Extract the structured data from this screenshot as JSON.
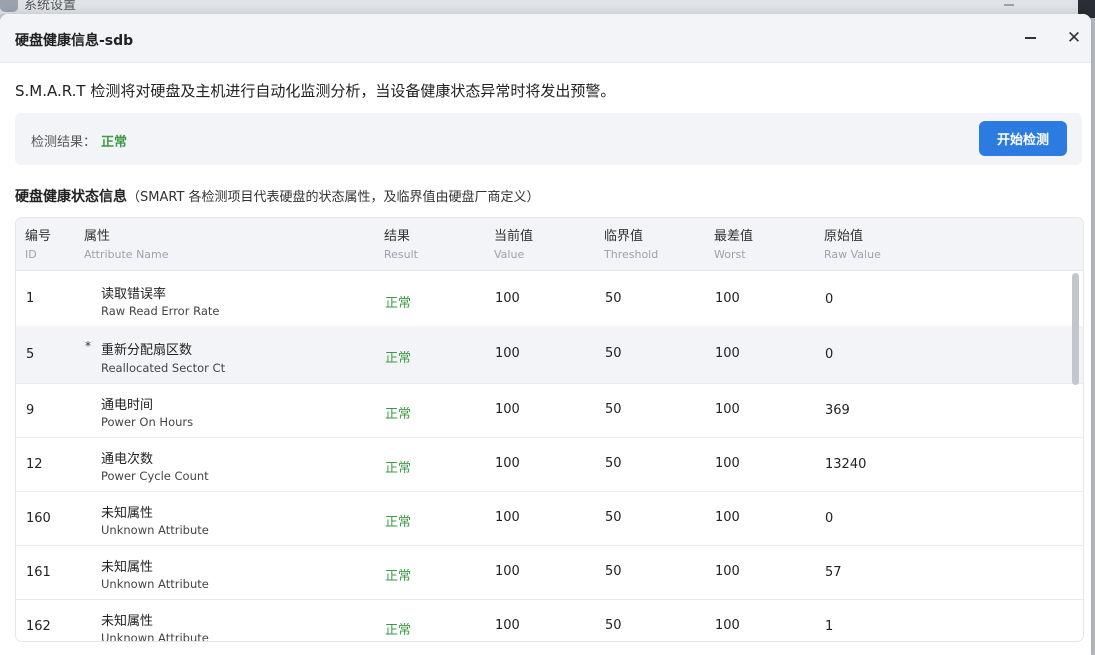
{
  "bg": {
    "title": "系统设置"
  },
  "dialog": {
    "title": "硬盘健康信息-sdb"
  },
  "description": "S.M.A.R.T 检测将对硬盘及主机进行自动化监测分析，当设备健康状态异常时将发出预警。",
  "result": {
    "label": "检测结果：",
    "value": "正常",
    "button": "开始检测"
  },
  "section": {
    "title": "硬盘健康状态信息",
    "note": "（SMART 各检测项目代表硬盘的状态属性，及临界值由硬盘厂商定义）"
  },
  "columns": [
    {
      "cn": "编号",
      "en": "ID"
    },
    {
      "cn": "属性",
      "en": "Attribute Name"
    },
    {
      "cn": "结果",
      "en": "Result"
    },
    {
      "cn": "当前值",
      "en": "Value"
    },
    {
      "cn": "临界值",
      "en": "Threshold"
    },
    {
      "cn": "最差值",
      "en": "Worst"
    },
    {
      "cn": "原始值",
      "en": "Raw Value"
    }
  ],
  "rows": [
    {
      "id": "1",
      "star": "",
      "name_cn": "读取错误率",
      "name_en": "Raw Read Error Rate",
      "result": "正常",
      "value": "100",
      "threshold": "50",
      "worst": "100",
      "raw": "0"
    },
    {
      "id": "5",
      "star": "*",
      "name_cn": "重新分配扇区数",
      "name_en": "Reallocated Sector Ct",
      "result": "正常",
      "value": "100",
      "threshold": "50",
      "worst": "100",
      "raw": "0"
    },
    {
      "id": "9",
      "star": "",
      "name_cn": "通电时间",
      "name_en": "Power On Hours",
      "result": "正常",
      "value": "100",
      "threshold": "50",
      "worst": "100",
      "raw": "369"
    },
    {
      "id": "12",
      "star": "",
      "name_cn": "通电次数",
      "name_en": "Power Cycle Count",
      "result": "正常",
      "value": "100",
      "threshold": "50",
      "worst": "100",
      "raw": "13240"
    },
    {
      "id": "160",
      "star": "",
      "name_cn": "未知属性",
      "name_en": "Unknown Attribute",
      "result": "正常",
      "value": "100",
      "threshold": "50",
      "worst": "100",
      "raw": "0"
    },
    {
      "id": "161",
      "star": "",
      "name_cn": "未知属性",
      "name_en": "Unknown Attribute",
      "result": "正常",
      "value": "100",
      "threshold": "50",
      "worst": "100",
      "raw": "57"
    },
    {
      "id": "162",
      "star": "",
      "name_cn": "未知属性",
      "name_en": "Unknown Attribute",
      "result": "正常",
      "value": "100",
      "threshold": "50",
      "worst": "100",
      "raw": "1"
    }
  ],
  "colors": {
    "accent": "#2c7be0",
    "ok": "#3e9a46"
  },
  "icons": {
    "minimize": "minimize-icon",
    "close": "close-icon"
  }
}
